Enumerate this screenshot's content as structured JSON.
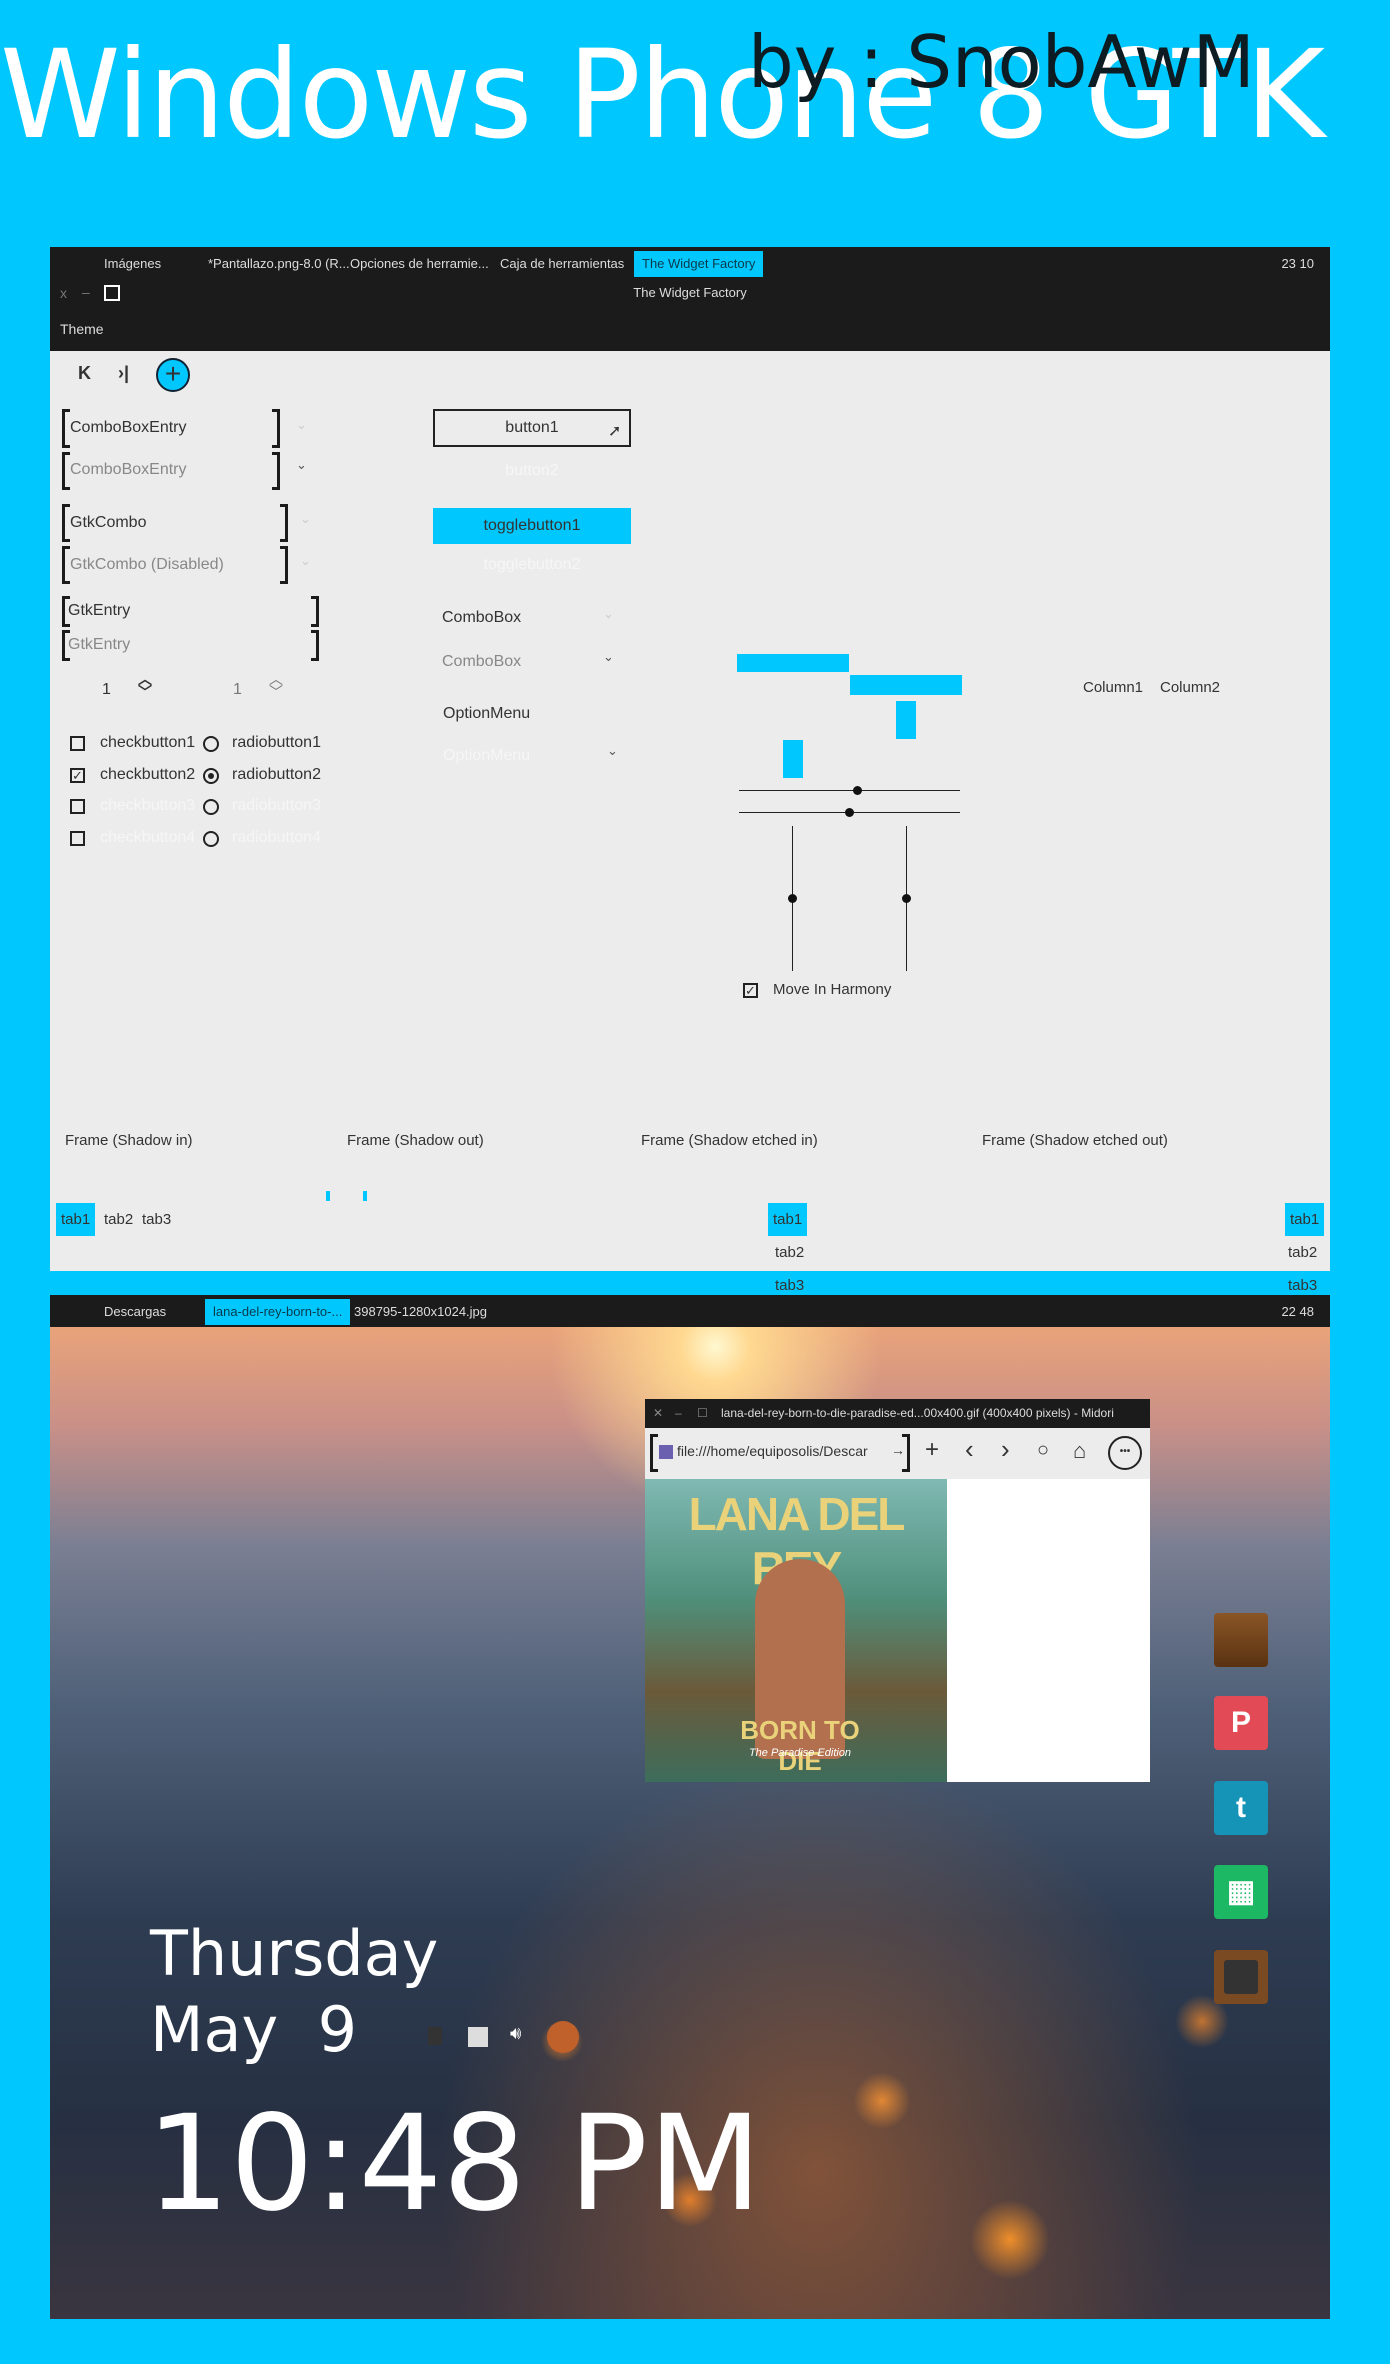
{
  "header": {
    "title": "Windows Phone 8 GTK",
    "byline": "by : SnobAwM"
  },
  "window1": {
    "taskbar": {
      "items": [
        "Imágenes",
        "*Pantallazo.png-8.0 (R...",
        "Opciones de herramie...",
        "Caja de herramientas",
        "The Widget Factory"
      ],
      "active_index": 4,
      "clock": "23 10"
    },
    "titlebar": {
      "title": "The Widget Factory",
      "close": "x",
      "minimize": "–",
      "maximize": "□"
    },
    "menu": {
      "theme": "Theme"
    },
    "toolbar": {
      "first": "K",
      "last": "›|",
      "add": "+"
    },
    "combo_entries": [
      "ComboBoxEntry",
      "ComboBoxEntry"
    ],
    "gtk_combos": [
      "GtkCombo",
      "GtkCombo (Disabled)"
    ],
    "entries": [
      "GtkEntry",
      "GtkEntry"
    ],
    "spin_values": [
      "1",
      "1"
    ],
    "checkbuttons": [
      {
        "label": "checkbutton1",
        "checked": false
      },
      {
        "label": "checkbutton2",
        "checked": true
      },
      {
        "label": "checkbutton3",
        "checked": false
      },
      {
        "label": "checkbutton4",
        "checked": false
      }
    ],
    "radiobuttons": [
      {
        "label": "radiobutton1",
        "selected": false
      },
      {
        "label": "radiobutton2",
        "selected": true
      },
      {
        "label": "radiobutton3",
        "selected": false
      },
      {
        "label": "radiobutton4",
        "selected": false
      }
    ],
    "buttons": [
      "button1",
      "button2"
    ],
    "togglebuttons": [
      "togglebutton1",
      "togglebutton2"
    ],
    "comboboxes": [
      "ComboBox",
      "ComboBox"
    ],
    "optionmenus": [
      "OptionMenu",
      "OptionMenu"
    ],
    "move_in_harmony": {
      "label": "Move In Harmony",
      "checked": true
    },
    "columns": [
      "Column1",
      "Column2"
    ],
    "frames": [
      "Frame (Shadow in)",
      "Frame (Shadow out)",
      "Frame (Shadow etched in)",
      "Frame (Shadow etched out)"
    ],
    "tabs": [
      "tab1",
      "tab2",
      "tab3"
    ],
    "accent": "#00c8ff"
  },
  "window2": {
    "taskbar": {
      "items": [
        "Descargas",
        "lana-del-rey-born-to-...",
        "398795-1280x1024.jpg"
      ],
      "active_index": 1,
      "clock": "22 48"
    },
    "midori": {
      "title": "lana-del-rey-born-to-die-paradise-ed...00x400.gif (400x400 pixels) - Midori",
      "url": "file:///home/equiposolis/Descar",
      "go": "→",
      "new_tab": "+",
      "back": "‹",
      "forward": "›",
      "reload": "○",
      "home": "⌂",
      "menu": "•••",
      "cover_artist": "LANA DEL REY",
      "cover_title": "BORN TO DIE",
      "cover_subtitle": "The Paradise Edition"
    },
    "lockscreen": {
      "day": "Thursday",
      "date": "May  9",
      "time": "10:48 PM"
    },
    "dock": [
      "folder-icon",
      "pinterest-icon",
      "tumblr-icon",
      "spreadsheet-icon",
      "tv-icon"
    ]
  }
}
